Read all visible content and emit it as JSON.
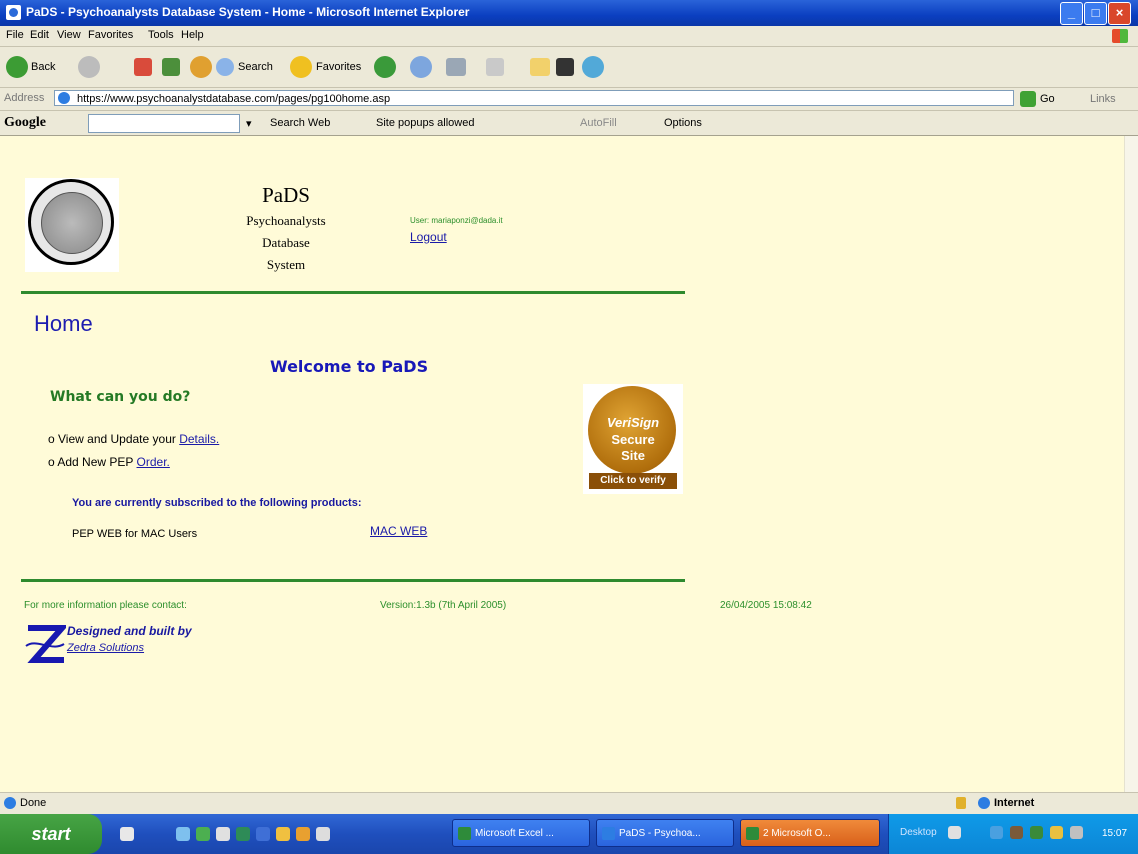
{
  "window": {
    "title": "PaDS - Psychoanalysts Database System - Home - Microsoft Internet Explorer"
  },
  "menu": [
    "File",
    "Edit",
    "View",
    "Favorites",
    "Tools",
    "Help"
  ],
  "toolbar": {
    "back": "Back",
    "search": "Search",
    "favorites": "Favorites"
  },
  "address": {
    "label": "Address",
    "url": "https://www.psychoanalystdatabase.com/pages/pg100home.asp",
    "go": "Go",
    "links": "Links"
  },
  "googlebar": {
    "logo": "Google",
    "search_web": "Search Web",
    "popups": "Site popups allowed",
    "autofill": "AutoFill",
    "options": "Options"
  },
  "page": {
    "logo_title": "PaDS",
    "logo_sub1": "Psychoanalysts",
    "logo_sub2": "Database",
    "logo_sub3": "System",
    "user_label": "User: mariaponzi@dada.it",
    "logout": "Logout",
    "heading": "Home",
    "welcome": "Welcome to PaDS",
    "what_can": "What can you do?",
    "bullet1_text": "View and Update your ",
    "bullet1_link": "Details.",
    "bullet2_text": "Add New PEP ",
    "bullet2_link": "Order.",
    "subscribed": "You are currently subscribed to the following products:",
    "product_name": "PEP WEB for MAC Users",
    "product_link": "MAC WEB",
    "verisign_brand": "VeriSign",
    "verisign_secure": "Secure",
    "verisign_site": "Site",
    "verisign_verify": "Click to verify",
    "contact": "For more information please contact:",
    "version": "Version:1.3b (7th April 2005)",
    "datetime": "26/04/2005 15:08:42",
    "designed": "Designed and built by",
    "zedra": "Zedra Solutions"
  },
  "status": {
    "text": "Done",
    "zone": "Internet"
  },
  "taskbar": {
    "start": "start",
    "tasks": [
      "Microsoft Excel ...",
      "PaDS - Psychoa...",
      "2 Microsoft O..."
    ],
    "desktop": "Desktop",
    "clock": "15:07"
  },
  "colors": {
    "page_bg": "#fffbd8",
    "green_rule": "#2e8a2e",
    "link_blue": "#1a1aa8",
    "heading_blue": "#1d1db0"
  }
}
